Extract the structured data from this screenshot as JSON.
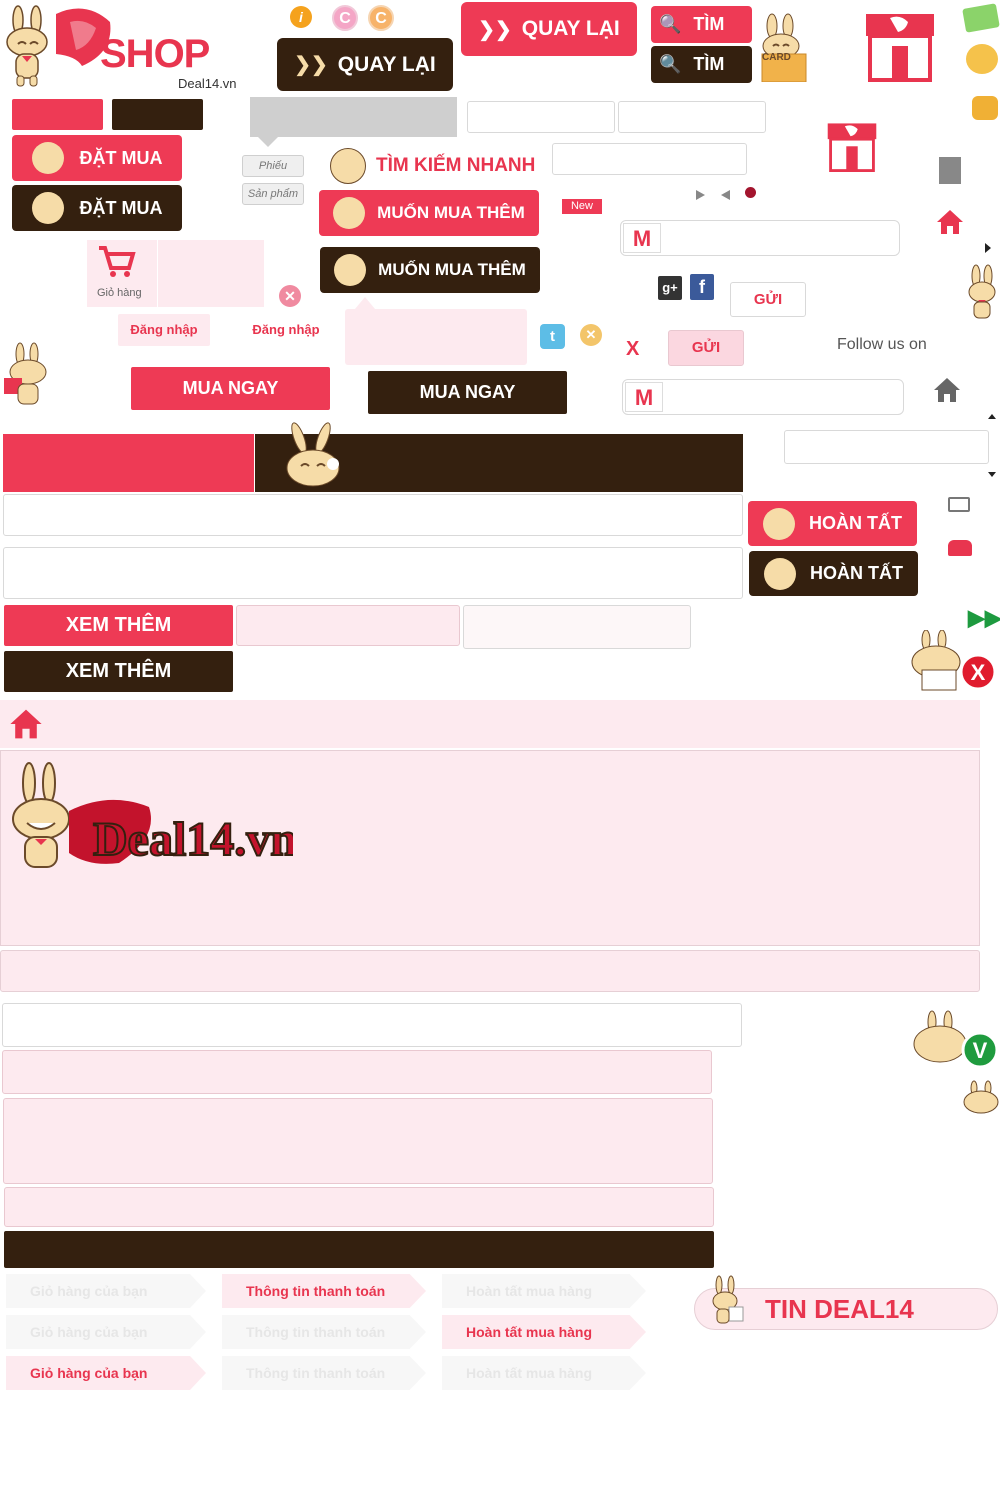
{
  "colors": {
    "brand_red": "#ee3a55",
    "brand_brown": "#34200f",
    "light_pink": "#fdeaef"
  },
  "logo": {
    "shop": "SHOP",
    "domain": "Deal14.vn"
  },
  "buttons": {
    "quay_lai": "QUAY LẠI",
    "tim": "TÌM",
    "dat_mua": "ĐẶT MUA",
    "muon_mua_them": "MUỐN MUA THÊM",
    "mua_ngay": "MUA NGAY",
    "hoan_tat": "HOÀN TẤT",
    "xem_them": "XEM THÊM",
    "gui": "GỬI"
  },
  "card_label": "CARD",
  "quick_search": "TÌM KIẾM NHANH",
  "tags": {
    "phieu": "Phiếu",
    "san_pham": "Sản phẩm",
    "new": "New"
  },
  "cart": {
    "label": "Giỏ hàng"
  },
  "login": {
    "label": "Đăng nhập"
  },
  "follow": "Follow us on",
  "close_x": "X",
  "checkout_steps": [
    "Giỏ hàng của bạn",
    "Thông tin thanh toán",
    "Hoàn tất mua hàng"
  ],
  "tin_deal": "TIN DEAL14",
  "deal_logo": "Deal14.vn",
  "badges": {
    "v": "V",
    "x": "X"
  }
}
